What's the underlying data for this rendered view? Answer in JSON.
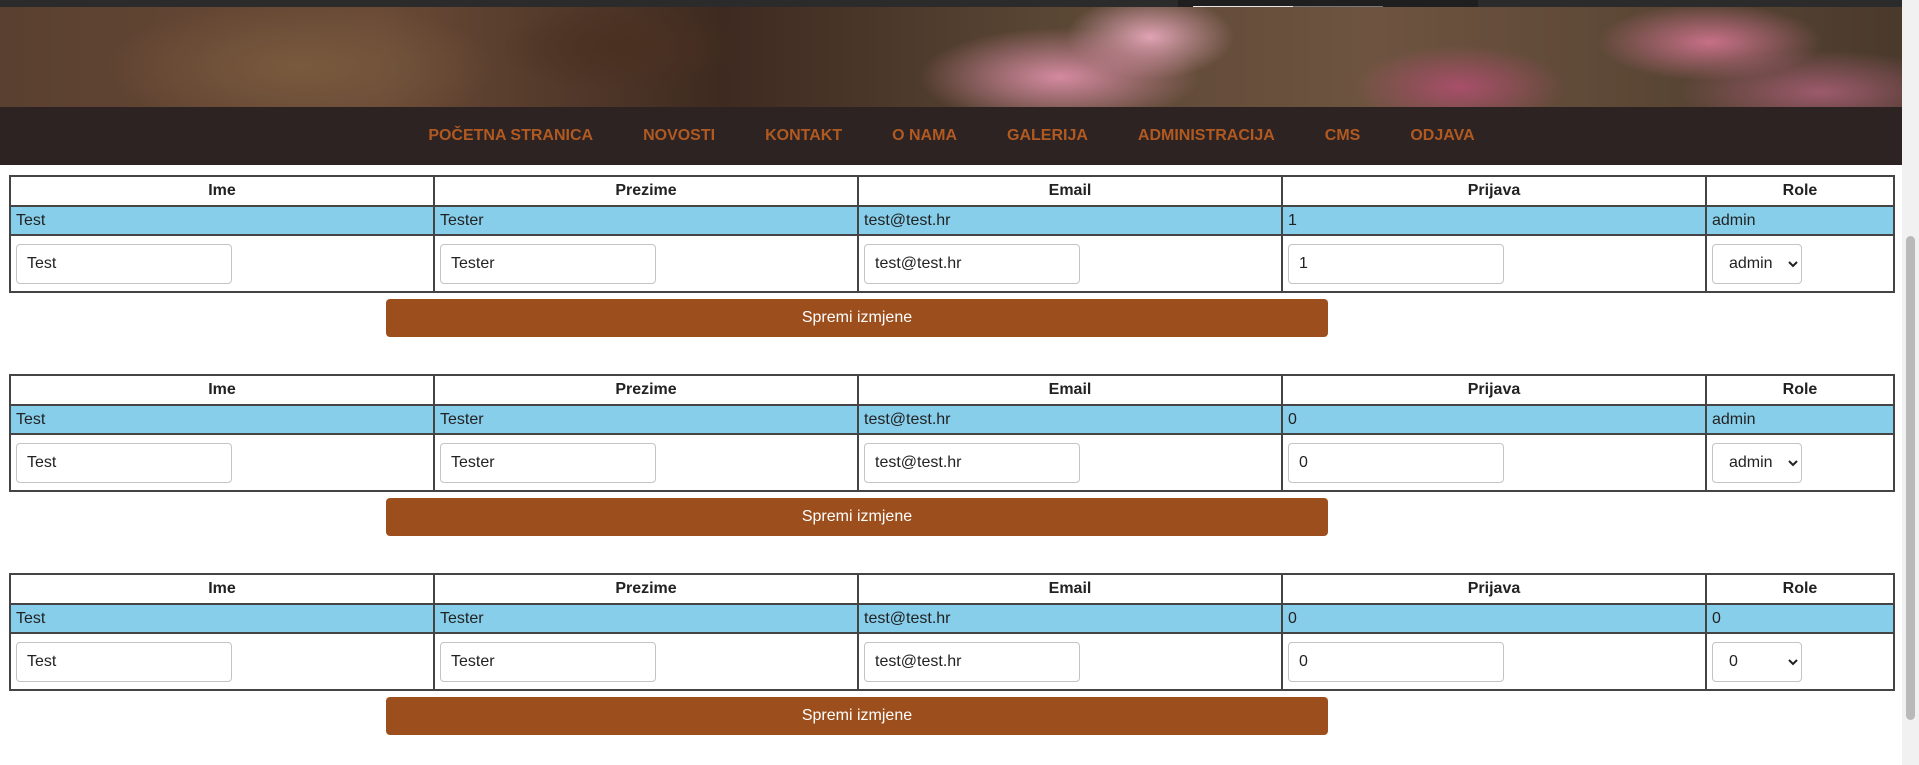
{
  "nav": {
    "items": [
      {
        "label": "POČETNA STRANICA"
      },
      {
        "label": "NOVOSTI"
      },
      {
        "label": "KONTAKT"
      },
      {
        "label": "O NAMA"
      },
      {
        "label": "GALERIJA"
      },
      {
        "label": "ADMINISTRACIJA"
      },
      {
        "label": "CMS"
      },
      {
        "label": "ODJAVA"
      }
    ]
  },
  "table_headers": [
    "Ime",
    "Prezime",
    "Email",
    "Prijava",
    "Role"
  ],
  "save_label": "Spremi izmjene",
  "users": [
    {
      "display": {
        "ime": "Test",
        "prezime": "Tester",
        "email": "test@test.hr",
        "prijava": "1",
        "role": "admin"
      },
      "form": {
        "ime": "Test",
        "prezime": "Tester",
        "email": "test@test.hr",
        "prijava": "1",
        "role": "admin"
      }
    },
    {
      "display": {
        "ime": "Test",
        "prezime": "Tester",
        "email": "test@test.hr",
        "prijava": "0",
        "role": "admin"
      },
      "form": {
        "ime": "Test",
        "prezime": "Tester",
        "email": "test@test.hr",
        "prijava": "0",
        "role": "admin"
      }
    },
    {
      "display": {
        "ime": "Test",
        "prezime": "Tester",
        "email": "test@test.hr",
        "prijava": "0",
        "role": "0"
      },
      "form": {
        "ime": "Test",
        "prezime": "Tester",
        "email": "test@test.hr",
        "prijava": "0",
        "role": "0"
      }
    }
  ],
  "colors": {
    "nav_background": "#2d2322",
    "nav_link": "#b05a22",
    "data_row": "#87ceeb",
    "save_button": "#9c4f1c"
  }
}
